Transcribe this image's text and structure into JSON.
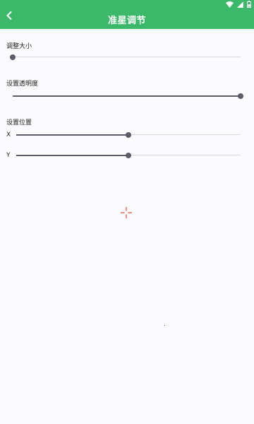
{
  "header": {
    "title": "准星调节",
    "back_icon": "chevron-left-icon",
    "status_icons": [
      "wifi-icon",
      "signal-icon",
      "battery-icon"
    ],
    "color": "#3CB86A"
  },
  "settings": {
    "size": {
      "label": "调整大小",
      "value": 0
    },
    "opacity": {
      "label": "设置透明度",
      "value": 1
    },
    "position": {
      "label": "设置位置",
      "x": {
        "label": "X",
        "value": 0.5
      },
      "y": {
        "label": "Y",
        "value": 0.5
      }
    }
  },
  "crosshair": {
    "icon": "crosshair-icon",
    "color": "#E0533A"
  }
}
